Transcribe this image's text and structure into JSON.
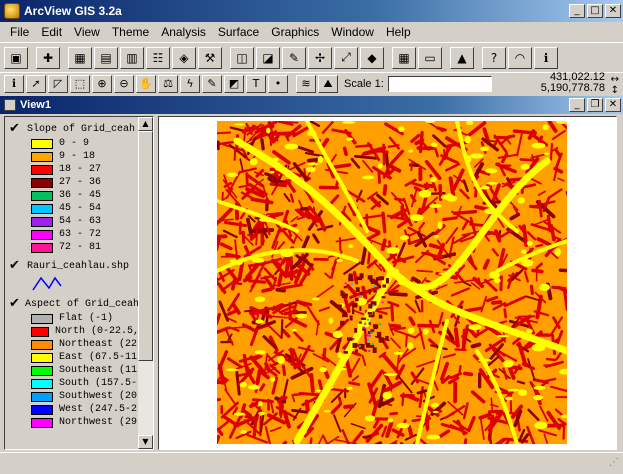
{
  "app": {
    "title": "ArcView GIS 3.2a"
  },
  "window_controls": {
    "minimize": "_",
    "restore": "□",
    "close": "✕"
  },
  "menu": [
    "File",
    "Edit",
    "View",
    "Theme",
    "Analysis",
    "Surface",
    "Graphics",
    "Window",
    "Help"
  ],
  "toolbar1": [
    {
      "name": "save-button",
      "icon": "save-icon",
      "glyph": "▣"
    },
    {
      "name": "add-theme-button",
      "icon": "plus-icon",
      "glyph": "✚"
    },
    {
      "name": "theme-properties-button",
      "icon": "properties-icon",
      "glyph": "▦"
    },
    {
      "name": "edit-legend-button",
      "icon": "legend-icon",
      "glyph": "▤"
    },
    {
      "name": "open-table-button",
      "icon": "table-icon",
      "glyph": "▥"
    },
    {
      "name": "query-builder-button",
      "icon": "query-icon",
      "glyph": "☷"
    },
    {
      "name": "locate-button",
      "icon": "locate-icon",
      "glyph": "◈"
    },
    {
      "name": "hammer-button",
      "icon": "hammer-icon",
      "glyph": "⚒"
    },
    {
      "name": "zoom-active-button",
      "icon": "zoom-layer-icon",
      "glyph": "◫"
    },
    {
      "name": "zoom-selected-button",
      "icon": "zoom-select-icon",
      "glyph": "◪"
    },
    {
      "name": "clear-selected-button",
      "icon": "pencil-icon",
      "glyph": "✎"
    },
    {
      "name": "zoom-in-full-button",
      "icon": "expand-icon",
      "glyph": "✢"
    },
    {
      "name": "zoom-full-button",
      "icon": "fullextent-icon",
      "glyph": "⤢"
    },
    {
      "name": "pan-arrow-button",
      "icon": "diamond-arrow-icon",
      "glyph": "◆"
    },
    {
      "name": "grid-select-button",
      "icon": "grid-icon",
      "glyph": "▦"
    },
    {
      "name": "layout-button",
      "icon": "layout-icon",
      "glyph": "▭"
    },
    {
      "name": "histogram-button",
      "icon": "histogram-icon",
      "glyph": "▲"
    },
    {
      "name": "help-button",
      "icon": "help-cursor-icon",
      "glyph": "?"
    },
    {
      "name": "hotlink-button",
      "icon": "hotlink-icon",
      "glyph": "◠"
    },
    {
      "name": "info-button",
      "icon": "info-icon",
      "glyph": "ℹ"
    }
  ],
  "toolbar2": [
    {
      "name": "identify-tool",
      "icon": "identify-icon",
      "glyph": "ℹ"
    },
    {
      "name": "pointer-tool",
      "icon": "pointer-icon",
      "glyph": "➚"
    },
    {
      "name": "vertex-edit-tool",
      "icon": "vertex-icon",
      "glyph": "◸"
    },
    {
      "name": "select-feature-tool",
      "icon": "select-icon",
      "glyph": "⬚"
    },
    {
      "name": "zoom-in-tool",
      "icon": "zoom-in-icon",
      "glyph": "⊕"
    },
    {
      "name": "zoom-out-tool",
      "icon": "zoom-out-icon",
      "glyph": "⊖"
    },
    {
      "name": "pan-tool",
      "icon": "hand-icon",
      "glyph": "✋"
    },
    {
      "name": "measure-tool",
      "icon": "measure-icon",
      "glyph": "⚖"
    },
    {
      "name": "hotlink-tool",
      "icon": "lightning-icon",
      "glyph": "ϟ"
    },
    {
      "name": "label-tool",
      "icon": "label-icon",
      "glyph": "✎"
    },
    {
      "name": "area-tool",
      "icon": "area-icon",
      "glyph": "◩"
    },
    {
      "name": "text-tool",
      "icon": "text-icon",
      "glyph": "T"
    },
    {
      "name": "point-tool",
      "icon": "point-icon",
      "glyph": "•"
    },
    {
      "name": "contour-tool",
      "icon": "contour-icon",
      "glyph": "≋"
    },
    {
      "name": "profile-tool",
      "icon": "profile-icon",
      "glyph": "⛰"
    }
  ],
  "scale": {
    "label": "Scale 1:",
    "value": ""
  },
  "coords": {
    "x": "431,022.12",
    "y": "5,190,778.78",
    "arrows": "↔\n↕"
  },
  "view": {
    "title": "View1"
  },
  "themes": [
    {
      "name": "Slope of Grid_ceah",
      "checked": "✔",
      "type": "legend",
      "classes": [
        {
          "label": "0 - 9",
          "color": "#ffff00"
        },
        {
          "label": "9 - 18",
          "color": "#ffa500"
        },
        {
          "label": "18 - 27",
          "color": "#ff0000"
        },
        {
          "label": "27 - 36",
          "color": "#8b0000"
        },
        {
          "label": "36 - 45",
          "color": "#00c060"
        },
        {
          "label": "45 - 54",
          "color": "#00c8ff"
        },
        {
          "label": "54 - 63",
          "color": "#a020f0"
        },
        {
          "label": "63 - 72",
          "color": "#ff00ff"
        },
        {
          "label": "72 - 81",
          "color": "#ff1493"
        }
      ]
    },
    {
      "name": "Rauri_ceahlau.shp",
      "checked": "✔",
      "type": "line",
      "line_color": "#0000ff"
    },
    {
      "name": "Aspect of Grid_ceah",
      "checked": "✔",
      "type": "legend",
      "classes": [
        {
          "label": "Flat (-1)",
          "color": "#b0b0b0"
        },
        {
          "label": "North (0-22.5,",
          "color": "#ff0000"
        },
        {
          "label": "Northeast (22",
          "color": "#ff8c00"
        },
        {
          "label": "East (67.5-11",
          "color": "#ffff00"
        },
        {
          "label": "Southeast (11",
          "color": "#00ff00"
        },
        {
          "label": "South (157.5-",
          "color": "#00ffff"
        },
        {
          "label": "Southwest (20",
          "color": "#00a0ff"
        },
        {
          "label": "West (247.5-2",
          "color": "#0000ff"
        },
        {
          "label": "Northwest (29",
          "color": "#ff00ff"
        }
      ]
    }
  ],
  "map": {
    "background": "#ff9f00",
    "ridge_color": "#ffff00",
    "steep_color": "#dd0000",
    "very_steep_color": "#8b0000"
  }
}
